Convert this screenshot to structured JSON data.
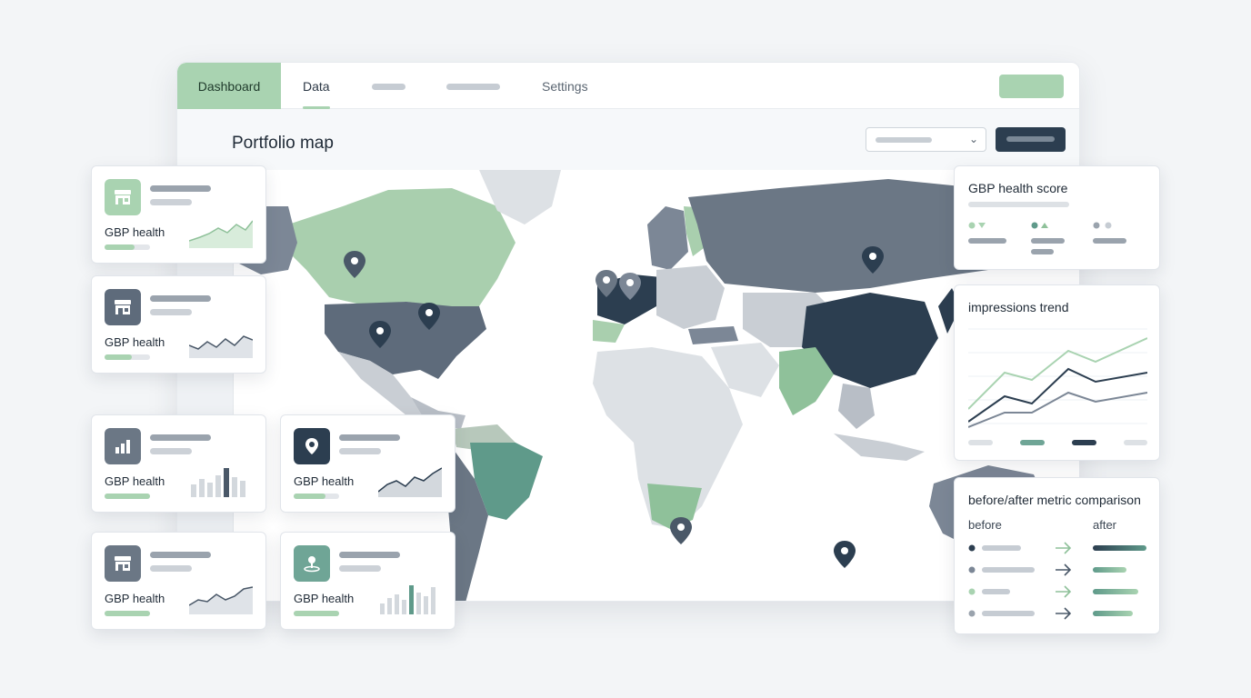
{
  "tabs": {
    "dashboard": "Dashboard",
    "data": "Data",
    "settings": "Settings"
  },
  "page": {
    "title": "Portfolio map"
  },
  "cards": [
    {
      "title": "GBP health",
      "icon": "storefront-icon",
      "progress": 0.65
    },
    {
      "title": "GBP health",
      "icon": "storefront-icon",
      "progress": 0.6
    },
    {
      "title": "GBP health",
      "icon": "bar-chart-icon",
      "progress": 1.0
    },
    {
      "title": "GBP health",
      "icon": "map-pin-icon",
      "progress": 0.7
    },
    {
      "title": "GBP health",
      "icon": "storefront-icon",
      "progress": 1.0
    },
    {
      "title": "GBP health",
      "icon": "location-person-icon",
      "progress": 1.0
    }
  ],
  "panels": {
    "health_score": {
      "title": "GBP health score"
    },
    "impressions": {
      "title": "impressions trend"
    },
    "comparison": {
      "title": "before/after metric comparison",
      "before": "before",
      "after": "after"
    }
  },
  "colors": {
    "accent_green": "#a9d3b1",
    "navy": "#2c3e50",
    "slate": "#6b7785",
    "teal": "#5f9a8a"
  }
}
